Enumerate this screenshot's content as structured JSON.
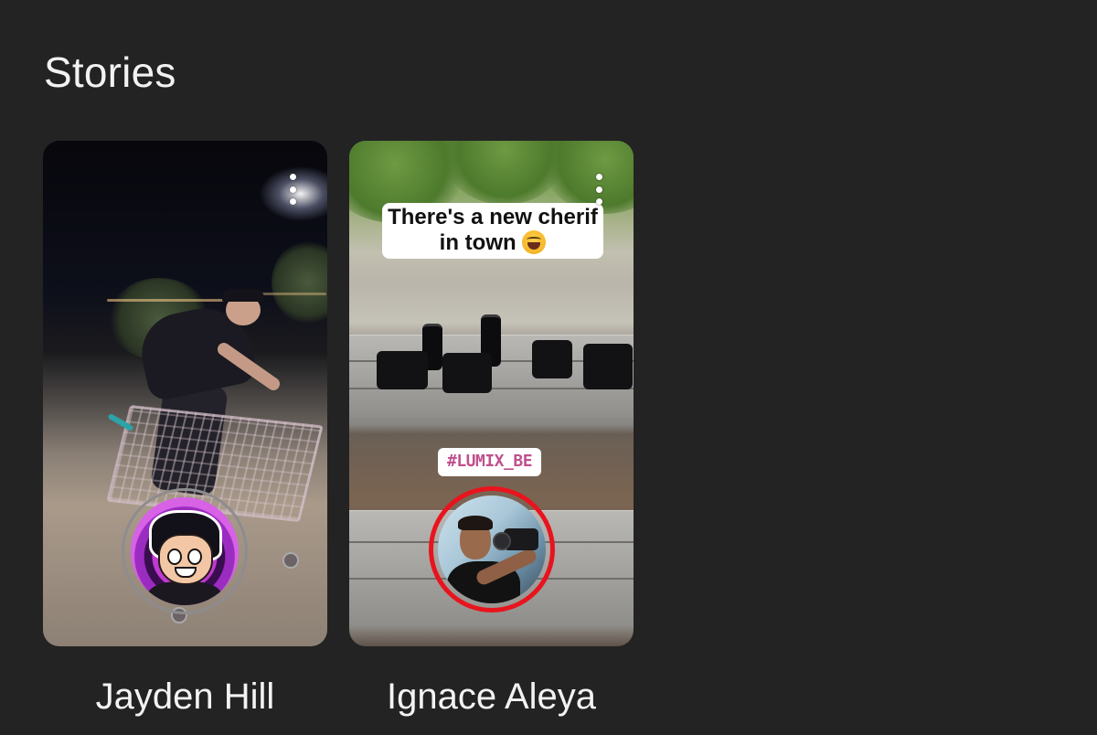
{
  "section": {
    "title": "Stories"
  },
  "stories": [
    {
      "name": "Jayden Hill",
      "ring": "viewed",
      "ring_color": "#8e8c8e",
      "menu_icon": "more-vertical-icon"
    },
    {
      "name": "Ignace Aleya",
      "ring": "unseen",
      "ring_color": "#e8141d",
      "menu_icon": "more-vertical-icon",
      "caption_line1": "There's a new cherif",
      "caption_line2": "in town",
      "caption_emoji": "grinning-squinting-face",
      "hashtag": "#LUMIX_BE"
    }
  ],
  "colors": {
    "background": "#232323",
    "text": "#f3f3f3",
    "unseen_ring": "#e8141d",
    "viewed_ring": "#8e8c8e"
  }
}
